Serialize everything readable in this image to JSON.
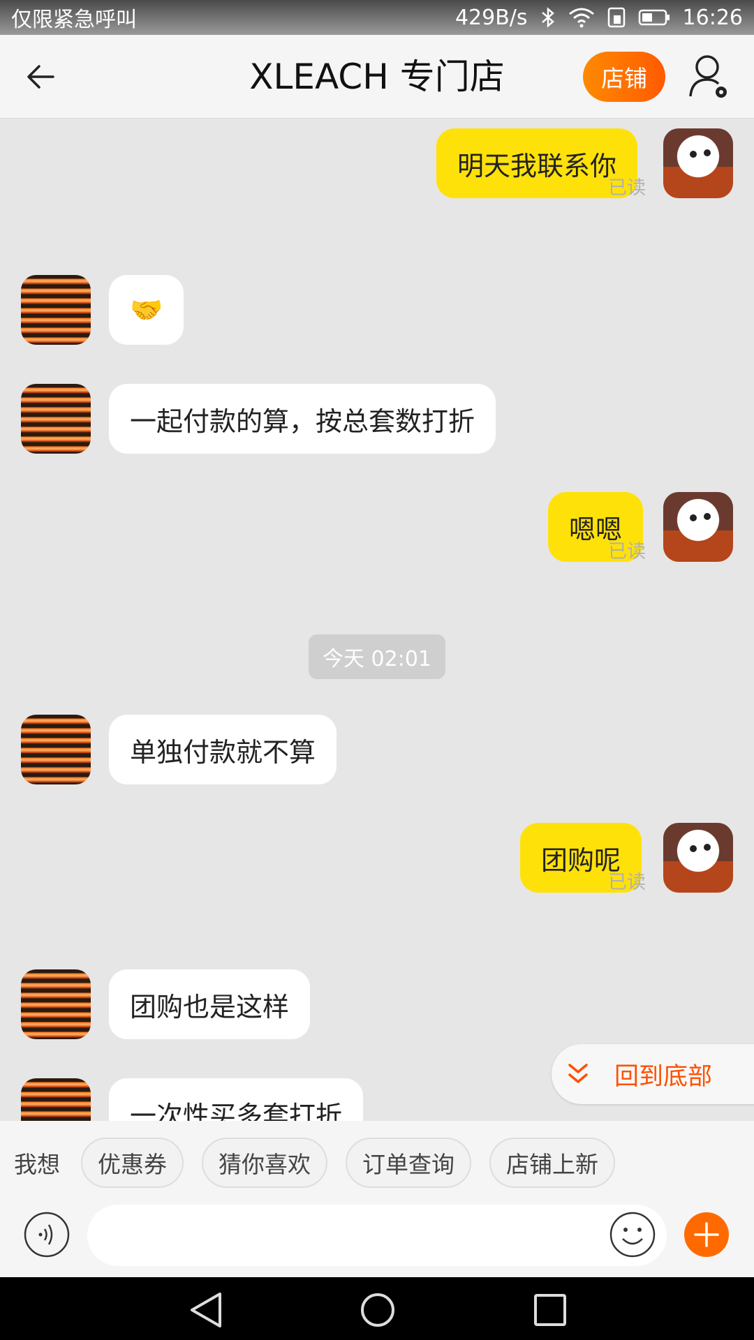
{
  "status_bar": {
    "carrier": "仅限紧急呼叫",
    "net_speed": "429B/s",
    "time": "16:26"
  },
  "header": {
    "title": "XLEACH 专门店",
    "shop_button": "店铺"
  },
  "messages": [
    {
      "side": "out",
      "text": "明天我联系你",
      "read": "已读"
    },
    {
      "side": "in",
      "text": "🤝"
    },
    {
      "side": "in",
      "text": "一起付款的算，按总套数打折"
    },
    {
      "side": "out",
      "text": "嗯嗯",
      "read": "已读"
    },
    {
      "side": "in",
      "text": "单独付款就不算"
    },
    {
      "side": "out",
      "text": "团购呢",
      "read": "已读"
    },
    {
      "side": "in",
      "text": "团购也是这样"
    },
    {
      "side": "in",
      "text": "一次性买多套打折"
    }
  ],
  "time_divider": "今天  02:01",
  "scroll_to_bottom": "回到底部",
  "quick_bar": {
    "label": "我想",
    "chips": [
      "优惠券",
      "猜你喜欢",
      "订单查询",
      "店铺上新"
    ]
  },
  "input": {
    "placeholder": ""
  },
  "colors": {
    "accent": "#ff6a00",
    "outgoing_bubble": "#ffe10a",
    "chat_background": "#e6e6e6"
  }
}
